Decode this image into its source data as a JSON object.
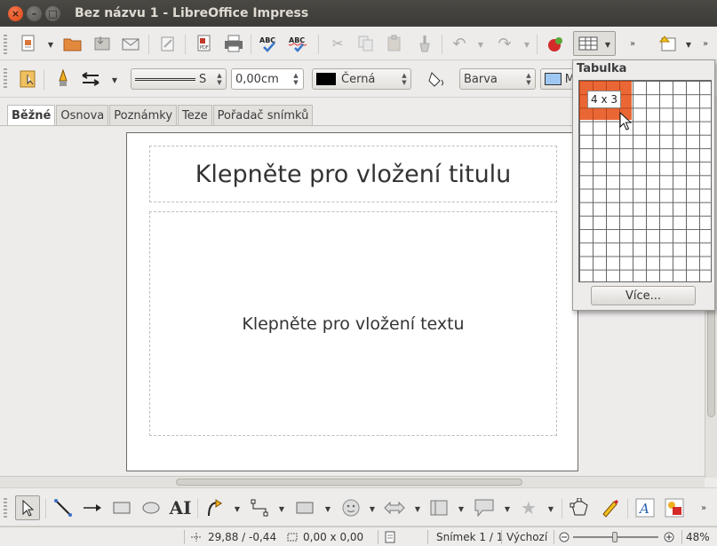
{
  "window": {
    "title": "Bez názvu 1 - LibreOffice Impress"
  },
  "line_toolbar": {
    "line_style_value": "S",
    "line_width_value": "0,00cm",
    "line_color_value": "Černá",
    "area_style_value": "Barva",
    "area_color_value": "M"
  },
  "tabs": [
    {
      "label": "Běžné",
      "active": true
    },
    {
      "label": "Osnova",
      "active": false
    },
    {
      "label": "Poznámky",
      "active": false
    },
    {
      "label": "Teze",
      "active": false
    },
    {
      "label": "Pořadač snímků",
      "active": false
    }
  ],
  "slide": {
    "title_placeholder": "Klepněte pro vložení titulu",
    "text_placeholder": "Klepněte pro vložení textu"
  },
  "table_popup": {
    "title": "Tabulka",
    "selection_label": "4 x 3",
    "selected_columns": 4,
    "selected_rows": 3,
    "more_button": "Více..."
  },
  "statusbar": {
    "position": "29,88 / -0,44",
    "size": "0,00 x 0,00",
    "slide_info": "Snímek 1 / 1",
    "master_page": "Výchozí",
    "zoom": "48%"
  },
  "colors": {
    "titlebar": "#3c3b37",
    "accent_selection": "#e95f2a",
    "close_button": "#d9430f"
  }
}
